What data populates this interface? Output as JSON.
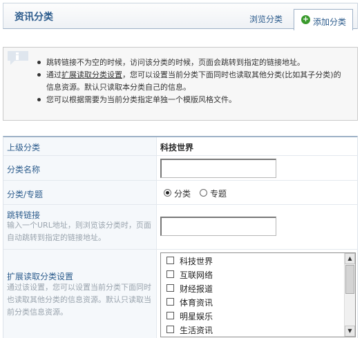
{
  "header": {
    "title": "资讯分类",
    "tabs": [
      {
        "label": "浏览分类",
        "active": false
      },
      {
        "label": "添加分类",
        "active": true
      }
    ]
  },
  "tips": {
    "items": [
      {
        "text": "跳转链接不为空的时候，访问该分类的时候，页面会跳转到指定的链接地址。"
      },
      {
        "prefix": "通过",
        "link": "扩展读取分类设置",
        "text": "，您可以设置当前分类下面同时也读取其他分类(比如其子分类)的信息资源。默认只读取本分类自己的信息。"
      },
      {
        "text": "您可以根据需要为当前分类指定单独一个模版风格文件。"
      }
    ]
  },
  "form": {
    "parent": {
      "label": "上级分类",
      "value": "科技世界"
    },
    "name": {
      "label": "分类名称",
      "value": ""
    },
    "type": {
      "label": "分类/专题",
      "options": [
        "分类",
        "专题"
      ],
      "selected": "分类"
    },
    "redirect": {
      "label": "跳转链接",
      "hint": "输入一个URL地址，则浏览该分类时，页面自动跳转到指定的链接地址。",
      "value": ""
    },
    "extend": {
      "label": "扩展读取分类设置",
      "hint": "通过该设置，您可以设置当前分类下面同时也读取其他分类的信息资源。默认只读取当前分类信息资源。",
      "options": [
        "科技世界",
        "互联网络",
        "财经报道",
        "体育资讯",
        "明星娱乐",
        "生活资讯"
      ]
    }
  },
  "colors": {
    "accent": "#2b5b8c",
    "add_icon": "#3a9a2c"
  }
}
